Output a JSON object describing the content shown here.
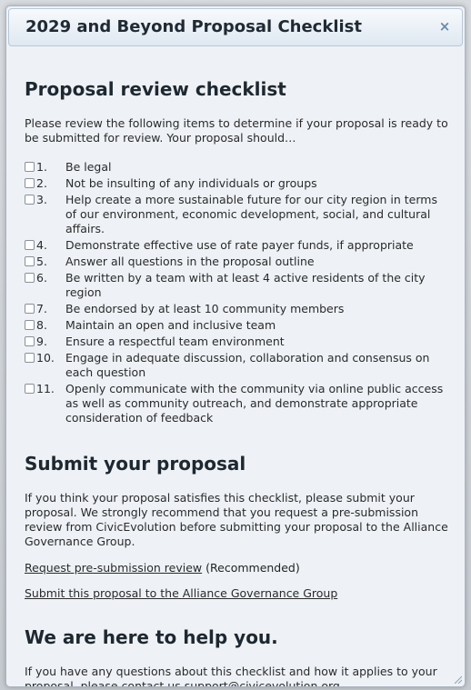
{
  "dialog": {
    "title": "2029 and Beyond Proposal Checklist",
    "close_glyph": "×"
  },
  "review": {
    "heading": "Proposal review checklist",
    "intro": "Please review the following items to determine if your proposal is ready to be submitted for review. Your proposal should…",
    "items": [
      {
        "num": "1.",
        "text": "Be legal"
      },
      {
        "num": "2.",
        "text": "Not be insulting of any individuals or groups"
      },
      {
        "num": "3.",
        "text": "Help create a more sustainable future for our city region in terms of our environment, economic development, social, and cultural affairs."
      },
      {
        "num": "4.",
        "text": "Demonstrate effective use of rate payer funds, if appropriate"
      },
      {
        "num": "5.",
        "text": "Answer all questions in the proposal outline"
      },
      {
        "num": "6.",
        "text": "Be written by a team with at least 4 active residents of the city region"
      },
      {
        "num": "7.",
        "text": "Be endorsed by at least 10 community members"
      },
      {
        "num": "8.",
        "text": "Maintain an open and inclusive team"
      },
      {
        "num": "9.",
        "text": "Ensure a respectful team environment"
      },
      {
        "num": "10.",
        "text": "Engage in adequate discussion, collaboration and consensus on each question"
      },
      {
        "num": "11.",
        "text": "Openly communicate with the community via online public access as well as community outreach, and demonstrate appropriate consideration of feedback"
      }
    ]
  },
  "submit": {
    "heading": "Submit your proposal",
    "text": "If you think your proposal satisfies this checklist, please submit your proposal. We strongly recommend that you request a pre-submission review from CivicEvolution before submitting your proposal to the Alliance Governance Group.",
    "review_link": "Request pre-submission review",
    "review_note": " (Recommended)",
    "submit_link": "Submit this proposal to the Alliance Governance Group"
  },
  "help": {
    "heading": "We are here to help you.",
    "text": "If you have any questions about this checklist and how it applies to your proposal, please contact us support@civicevolution.org."
  },
  "colors": {
    "dialog_bg": "#eef2f6",
    "titlebar_border": "#b8c7d6",
    "close_icon": "#6b8aa8"
  }
}
